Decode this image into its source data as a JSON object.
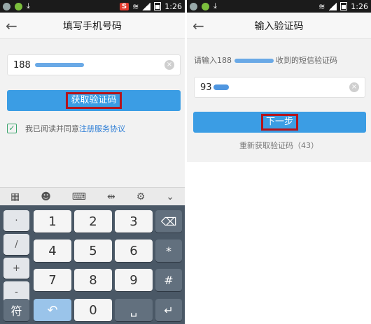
{
  "left": {
    "status_time": "1:26",
    "status_badge": "S",
    "title": "填写手机号码",
    "phone_prefix": "188",
    "get_code_label": "获取验证码",
    "agree_text": "我已阅读并同意",
    "agree_link": "注册服务协议",
    "keys": {
      "dot": "·",
      "slash": "/",
      "plus": "+",
      "minus": "-",
      "sym": "符",
      "n1": "1",
      "n2": "2",
      "n3": "3",
      "n4": "4",
      "n5": "5",
      "n6": "6",
      "n7": "7",
      "n8": "8",
      "n9": "9",
      "n0": "0",
      "star": "*",
      "hash": "#"
    }
  },
  "right": {
    "status_time": "1:26",
    "title": "输入验证码",
    "hint_prefix": "请输入188",
    "hint_suffix": "收到的短信验证码",
    "code_prefix": "93",
    "next_label": "下一步",
    "resend_label": "重新获取验证码（43）"
  }
}
